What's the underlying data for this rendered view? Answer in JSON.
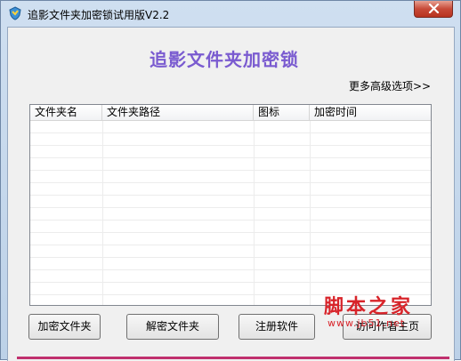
{
  "window": {
    "title": "追影文件夹加密锁试用版V2.2"
  },
  "main": {
    "heading": "追影文件夹加密锁",
    "more_options_link": "更多高级选项>>"
  },
  "folder_list": {
    "columns": [
      "文件夹名",
      "文件夹路径",
      "图标",
      "加密时间"
    ],
    "rows": []
  },
  "buttons": {
    "encrypt_label": "加密文件夹",
    "decrypt_label": "解密文件夹",
    "register_label": "注册软件",
    "visit_label": "访问作者主页"
  },
  "watermark": {
    "title": "脚本之家",
    "url": "www.jb51.net"
  },
  "colors": {
    "heading": "#7a5bd0",
    "watermark": "#d8242a",
    "bottom_bar": "#c0306e"
  }
}
